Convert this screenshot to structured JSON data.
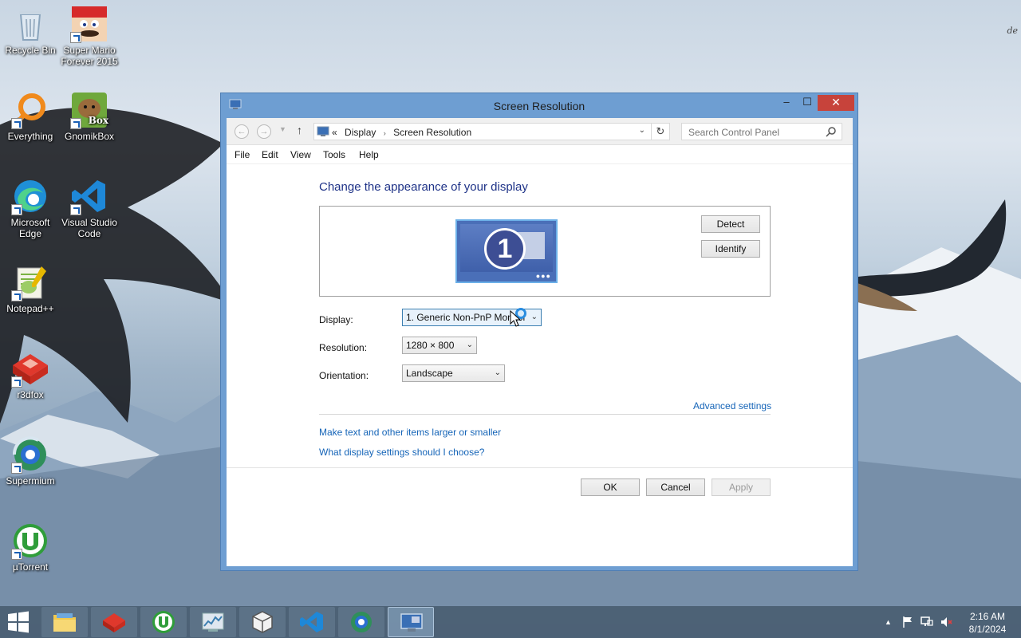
{
  "wallpaper": {
    "corner_text": "de"
  },
  "desktop_icons": [
    {
      "label": "Recycle Bin",
      "icon": "recycle-bin-icon"
    },
    {
      "label": "Super Mario Forever 2015",
      "icon": "mario-icon"
    },
    {
      "label": "Everything",
      "icon": "everything-search-icon"
    },
    {
      "label": "GnomikBox",
      "icon": "gnomikbox-icon",
      "badge": "Box"
    },
    {
      "label": "Microsoft Edge",
      "icon": "edge-icon"
    },
    {
      "label": "Visual Studio Code",
      "icon": "vscode-icon"
    },
    {
      "label": "Notepad++",
      "icon": "notepad-plus-plus-icon"
    },
    {
      "label": "r3dfox",
      "icon": "r3dfox-icon"
    },
    {
      "label": "Supermium",
      "icon": "supermium-icon"
    },
    {
      "label": "µTorrent",
      "icon": "utorrent-icon"
    }
  ],
  "window": {
    "title": "Screen Resolution",
    "controls": {
      "minimize": "–",
      "maximize": "☐",
      "close": "✕"
    },
    "address": {
      "prefix": "«",
      "crumbs": [
        "Display",
        "Screen Resolution"
      ],
      "separator": "›"
    },
    "search": {
      "placeholder": "Search Control Panel"
    },
    "menu": [
      "File",
      "Edit",
      "View",
      "Tools",
      "Help"
    ],
    "heading": "Change the appearance of your display",
    "monitor_number": "1",
    "buttons": {
      "detect": "Detect",
      "identify": "Identify",
      "ok": "OK",
      "cancel": "Cancel",
      "apply": "Apply"
    },
    "fields": {
      "display_label": "Display:",
      "display_value": "1. Generic Non-PnP Monitor",
      "resolution_label": "Resolution:",
      "resolution_value": "1280 × 800",
      "orientation_label": "Orientation:",
      "orientation_value": "Landscape"
    },
    "links": {
      "advanced": "Advanced settings",
      "text_size": "Make text and other items larger or smaller",
      "which_settings": "What display settings should I choose?"
    }
  },
  "taskbar": {
    "items": [
      "start-button",
      "file-explorer",
      "r3dfox",
      "utorrent",
      "task-manager",
      "virtualbox",
      "vscode",
      "supermium",
      "screen-resolution"
    ],
    "clock": {
      "time": "2:16 AM",
      "date": "8/1/2024"
    }
  },
  "colors": {
    "accent": "#1665b8",
    "heading": "#1e3287",
    "window_frame": "#6e9ed2",
    "close_button": "#c7433b"
  }
}
